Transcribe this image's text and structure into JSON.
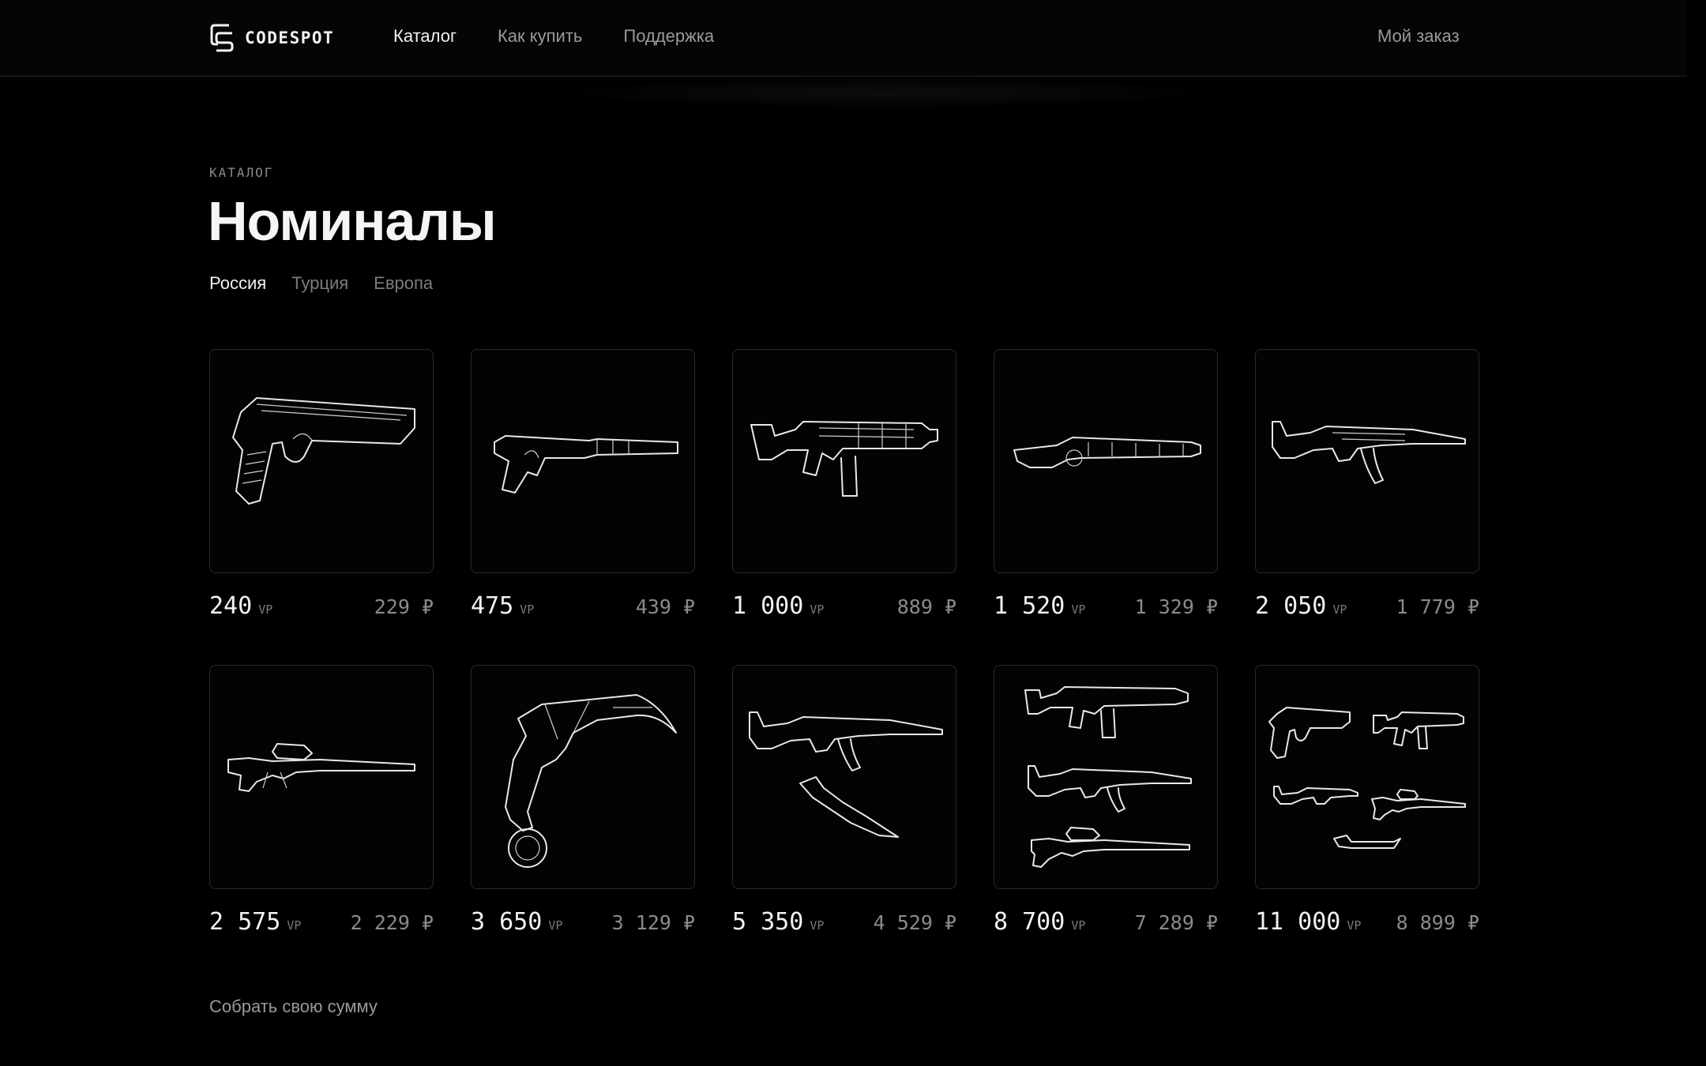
{
  "header": {
    "brand": "CODESPOT",
    "nav": [
      {
        "label": "Каталог",
        "active": true
      },
      {
        "label": "Как купить",
        "active": false
      },
      {
        "label": "Поддержка",
        "active": false
      }
    ],
    "order_label": "Мой заказ"
  },
  "page": {
    "eyebrow": "КАТАЛОГ",
    "title": "Номиналы",
    "regions": [
      {
        "label": "Россия",
        "active": true
      },
      {
        "label": "Турция",
        "active": false
      },
      {
        "label": "Европа",
        "active": false
      }
    ]
  },
  "products": [
    {
      "vp": "240",
      "vp_unit": "VP",
      "price": "229 ₽",
      "icon": "pistol-icon"
    },
    {
      "vp": "475",
      "vp_unit": "VP",
      "price": "439 ₽",
      "icon": "silenced-pistol-icon"
    },
    {
      "vp": "1 000",
      "vp_unit": "VP",
      "price": "889 ₽",
      "icon": "smg-icon"
    },
    {
      "vp": "1 520",
      "vp_unit": "VP",
      "price": "1 329 ₽",
      "icon": "shotgun-icon"
    },
    {
      "vp": "2 050",
      "vp_unit": "VP",
      "price": "1 779 ₽",
      "icon": "rifle-icon"
    },
    {
      "vp": "2 575",
      "vp_unit": "VP",
      "price": "2 229 ₽",
      "icon": "sniper-rifle-icon"
    },
    {
      "vp": "3 650",
      "vp_unit": "VP",
      "price": "3 129 ₽",
      "icon": "karambit-knife-icon"
    },
    {
      "vp": "5 350",
      "vp_unit": "VP",
      "price": "4 529 ₽",
      "icon": "rifle-and-knife-icon"
    },
    {
      "vp": "8 700",
      "vp_unit": "VP",
      "price": "7 289 ₽",
      "icon": "weapon-set-three-icon"
    },
    {
      "vp": "11 000",
      "vp_unit": "VP",
      "price": "8 899 ₽",
      "icon": "weapon-set-five-icon"
    }
  ],
  "footer": {
    "custom_sum_label": "Собрать свою сумму"
  }
}
